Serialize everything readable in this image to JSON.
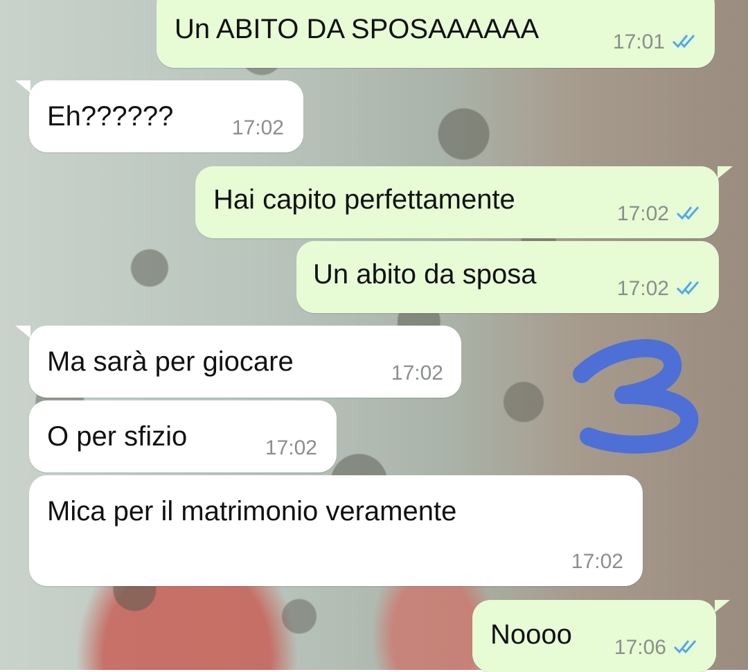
{
  "colors": {
    "outgoing_bubble": "#e7fbd5",
    "incoming_bubble": "#ffffff",
    "read_ticks": "#4fa9e8",
    "timestamp": "#8a8f8a",
    "scribble": "#4e6fd6"
  },
  "messages": [
    {
      "direction": "out",
      "text": "Un ABITO DA SPOSAAAAAA",
      "time": "17:01",
      "status": "read"
    },
    {
      "direction": "in",
      "text": "Eh??????",
      "time": "17:02"
    },
    {
      "direction": "out",
      "text": "Hai capito perfettamente",
      "time": "17:02",
      "status": "read"
    },
    {
      "direction": "out",
      "text": "Un abito da sposa",
      "time": "17:02",
      "status": "read"
    },
    {
      "direction": "in",
      "text": "Ma sarà per giocare",
      "time": "17:02"
    },
    {
      "direction": "in",
      "text": "O per sfizio",
      "time": "17:02"
    },
    {
      "direction": "in",
      "text": "Mica per il matrimonio veramente",
      "time": "17:02"
    },
    {
      "direction": "out",
      "text": "Noooo",
      "time": "17:06",
      "status": "read"
    }
  ],
  "annotation": {
    "icon": "handwritten-number-3"
  }
}
